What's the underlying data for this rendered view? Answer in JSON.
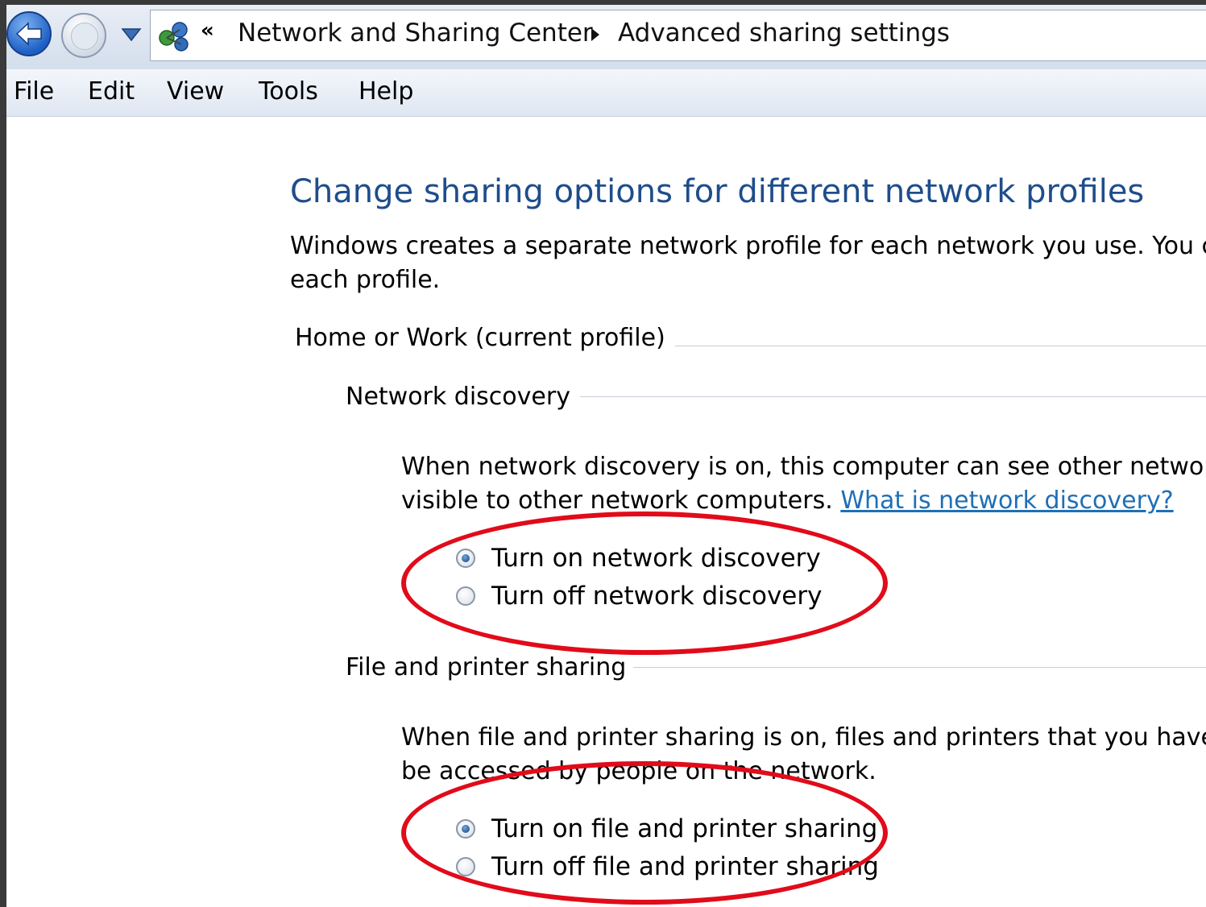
{
  "address_bar": {
    "chevrons": "«",
    "breadcrumb": [
      "Network and Sharing Center",
      "Advanced sharing settings"
    ]
  },
  "menu": [
    "File",
    "Edit",
    "View",
    "Tools",
    "Help"
  ],
  "content": {
    "title": "Change sharing options for different network profiles",
    "intro_line1": "Windows creates a separate network profile for each network you use. You can",
    "intro_line2": "each profile.",
    "profile_heading": "Home or Work (current profile)",
    "network_discovery": {
      "heading": "Network discovery",
      "desc_line1": "When network discovery is on, this computer can see other network c",
      "desc_line2": "visible to other network computers.",
      "link": "What is network discovery?",
      "options": [
        {
          "label": "Turn on network discovery",
          "selected": true
        },
        {
          "label": "Turn off network discovery",
          "selected": false
        }
      ]
    },
    "file_printer_sharing": {
      "heading": "File and printer sharing",
      "desc_line1": "When file and printer sharing is on, files and printers that you have sh",
      "desc_line2": "be accessed by people on the network.",
      "options": [
        {
          "label": "Turn on file and printer sharing",
          "selected": true
        },
        {
          "label": "Turn off file and printer sharing",
          "selected": false
        }
      ]
    }
  },
  "annotation_color": "#e10b1a",
  "icons": [
    "back-arrow-icon",
    "forward-arrow-icon",
    "dropdown-arrow-icon",
    "network-icon",
    "breadcrumb-arrow-icon"
  ]
}
